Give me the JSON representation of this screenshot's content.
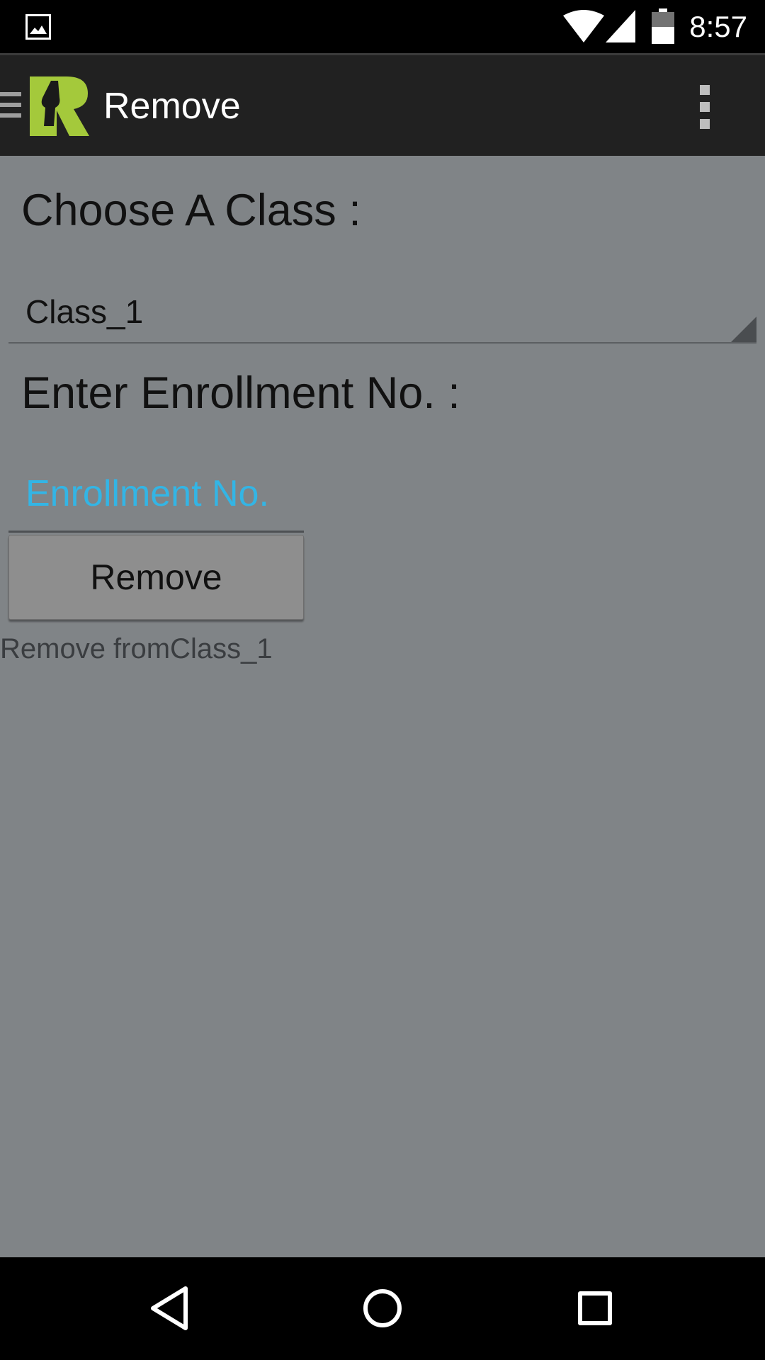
{
  "status_bar": {
    "time": "8:57",
    "icons": [
      "image-notification-icon",
      "wifi-icon",
      "cell-signal-icon",
      "battery-icon"
    ]
  },
  "action_bar": {
    "title": "Remove",
    "icons": [
      "drawer-icon",
      "app-logo",
      "overflow-menu-icon"
    ],
    "brand_color": "#a4c93b"
  },
  "form": {
    "class_label": "Choose A Class :",
    "class_selected": "Class_1",
    "enroll_label": "Enter Enrollment No. :",
    "enroll_value": "",
    "enroll_placeholder": "Enrollment No.",
    "remove_button_label": "Remove",
    "status_text": "Remove fromClass_1"
  },
  "nav_bar": {
    "buttons": [
      "back-icon",
      "home-icon",
      "recents-icon"
    ]
  },
  "colors": {
    "background": "#808487",
    "action_bar": "#212121",
    "hint": "#33b5e5"
  }
}
